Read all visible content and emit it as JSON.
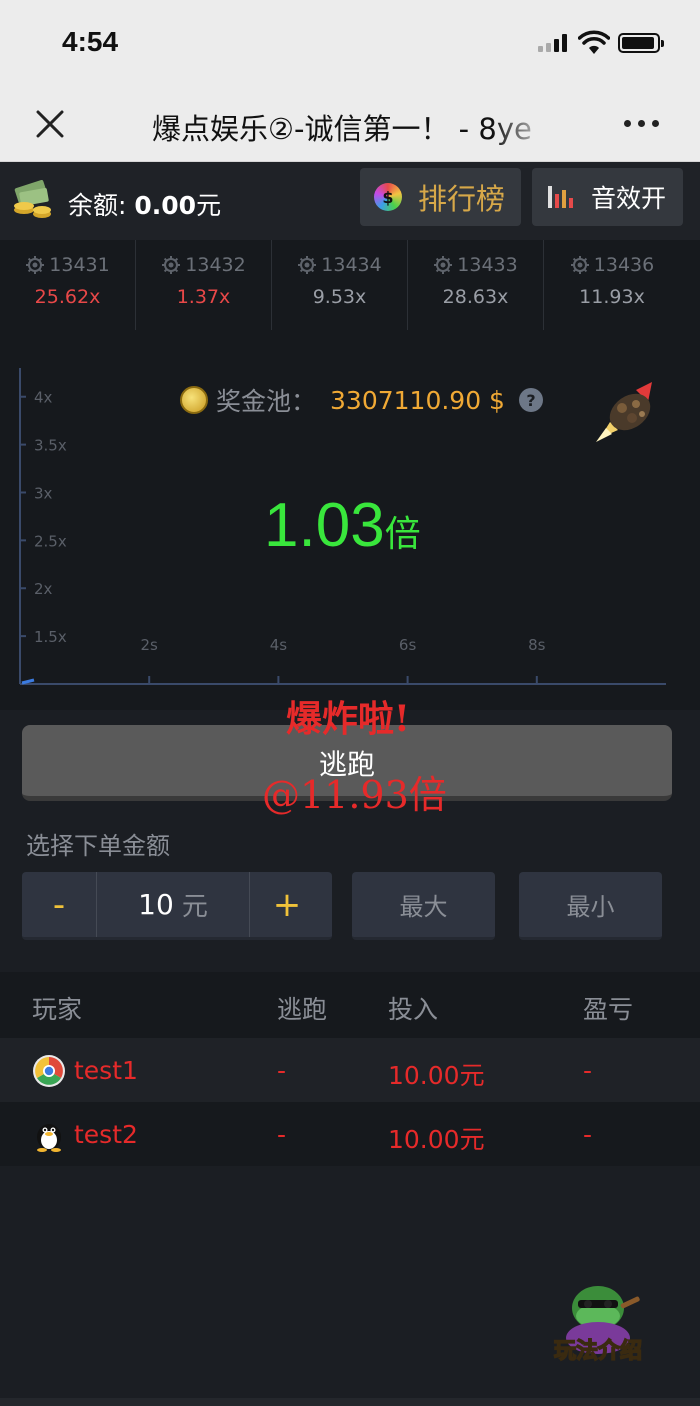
{
  "status_bar": {
    "time": "4:54"
  },
  "nav": {
    "title": "爆点娱乐②-诚信第一！ - 8ye"
  },
  "topbar": {
    "balance_label": "余额: ",
    "balance_value": "0.00",
    "balance_unit": "元",
    "rank_label": "排行榜",
    "rank_icon_glyph": "$",
    "sound_label": "音效开"
  },
  "history": [
    {
      "id": "13431",
      "multiplier": "25.62x",
      "color": "#e84848"
    },
    {
      "id": "13432",
      "multiplier": "1.37x",
      "color": "#e84848"
    },
    {
      "id": "13434",
      "multiplier": "9.53x",
      "color": "#9a9ea6"
    },
    {
      "id": "13433",
      "multiplier": "28.63x",
      "color": "#9a9ea6"
    },
    {
      "id": "13436",
      "multiplier": "11.93x",
      "color": "#9a9ea6"
    }
  ],
  "pool": {
    "label": "奖金池：",
    "value": "3307110.90 $",
    "help": "?"
  },
  "chart_data": {
    "type": "line",
    "y_ticks": [
      "4x",
      "3.5x",
      "3x",
      "2.5x",
      "2x",
      "1.5x"
    ],
    "x_ticks": [
      "2s",
      "4s",
      "6s",
      "8s"
    ],
    "y_values": [
      4,
      3.5,
      3,
      2.5,
      2,
      1.5
    ],
    "x_values": [
      2,
      4,
      6,
      8
    ],
    "ylim": [
      1,
      4.3
    ],
    "xlim": [
      0,
      10
    ]
  },
  "game": {
    "multiplier": "1.03",
    "multiplier_unit": "倍",
    "crash_text": "爆炸啦!",
    "crash_at": "@11.93倍",
    "escape_label": "逃跑"
  },
  "amount": {
    "label": "选择下单金额",
    "minus": "-",
    "plus": "+",
    "value": "10",
    "unit": "元",
    "max_label": "最大",
    "min_label": "最小"
  },
  "table": {
    "headers": {
      "player": "玩家",
      "escape": "逃跑",
      "bet": "投入",
      "profit": "盈亏"
    },
    "rows": [
      {
        "player": "test1",
        "escape": "-",
        "bet": "10.00元",
        "profit": "-"
      },
      {
        "player": "test2",
        "escape": "-",
        "bet": "10.00元",
        "profit": "-"
      }
    ]
  },
  "guide": {
    "label": "玩法介绍"
  },
  "colors": {
    "accent_gold": "#d7a849",
    "crash_red": "#e62a2a",
    "multiplier_green": "#39e63c",
    "pool_orange": "#f0a935"
  }
}
